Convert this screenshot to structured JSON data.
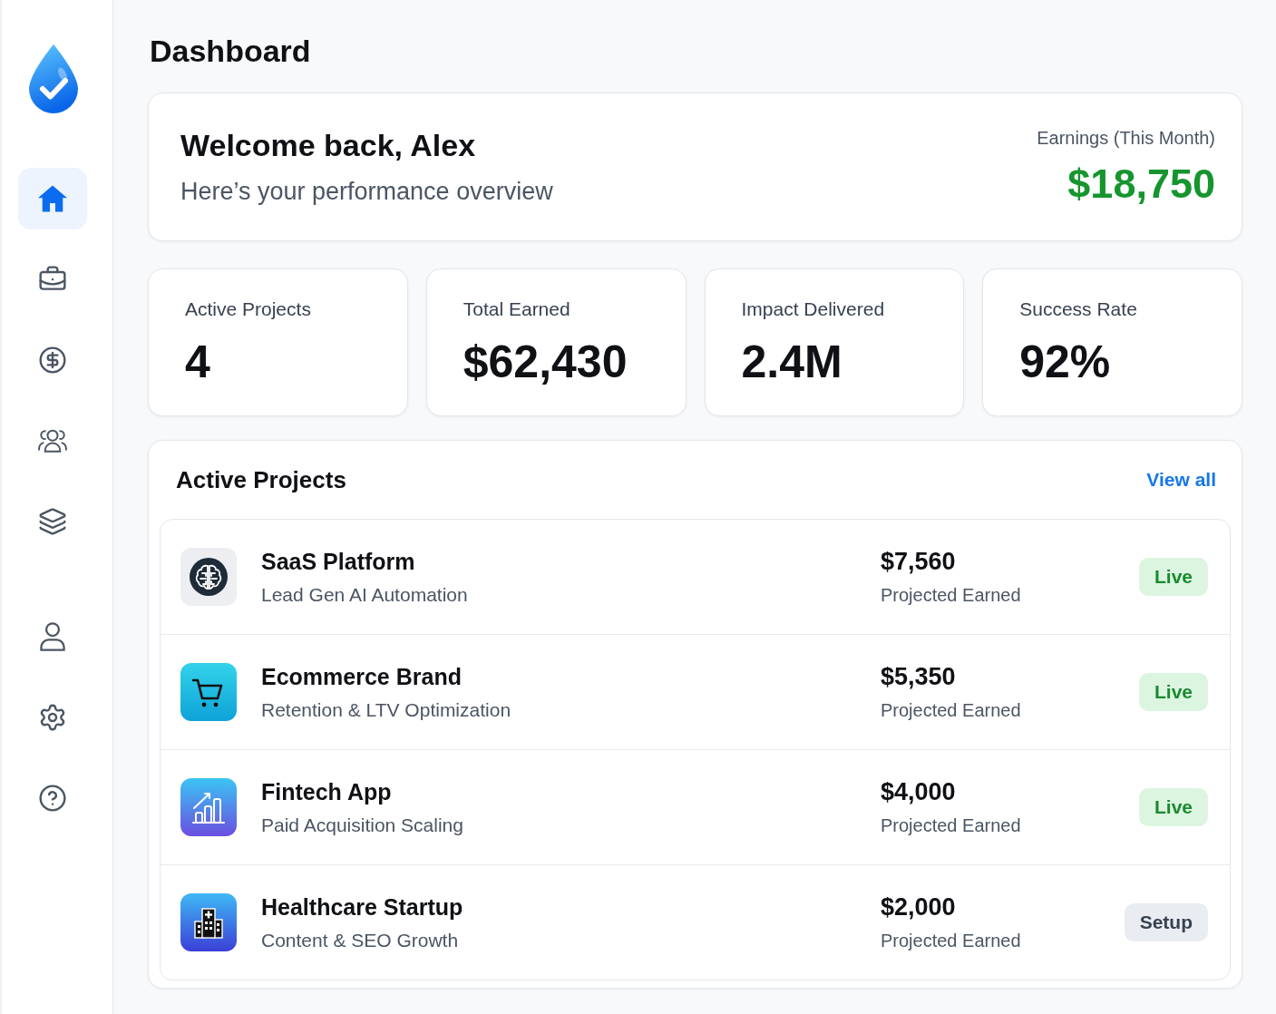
{
  "sidebar": {
    "items": [
      {
        "kind": "home",
        "selected": true
      },
      {
        "kind": "briefcase",
        "selected": false
      },
      {
        "kind": "dollar",
        "selected": false
      },
      {
        "kind": "people",
        "selected": false
      },
      {
        "kind": "layers",
        "selected": false
      }
    ],
    "lower_items": [
      {
        "kind": "user",
        "selected": false
      },
      {
        "kind": "gear",
        "selected": false
      },
      {
        "kind": "help",
        "selected": false
      }
    ]
  },
  "page_title": "Dashboard",
  "welcome": {
    "title": "Welcome back, Alex",
    "subtitle": "Here’s your performance overview",
    "earnings_label": "Earnings (This Month)",
    "earnings_value": "$18,750"
  },
  "stats": [
    {
      "label": "Active Projects",
      "value": "4"
    },
    {
      "label": "Total Earned",
      "value": "$62,430"
    },
    {
      "label": "Impact Delivered",
      "value": "2.4M"
    },
    {
      "label": "Success Rate",
      "value": "92%"
    }
  ],
  "projects": {
    "title": "Active Projects",
    "view_all": "View all",
    "rows": [
      {
        "kind": "brain",
        "name": "SaaS Platform",
        "description": "Lead Gen AI Automation",
        "amount": "$7,560",
        "amount_label": "Projected Earned",
        "status": {
          "kind": "live",
          "label": "Live"
        }
      },
      {
        "kind": "cart",
        "name": "Ecommerce Brand",
        "description": "Retention & LTV Optimization",
        "amount": "$5,350",
        "amount_label": "Projected Earned",
        "status": {
          "kind": "live",
          "label": "Live"
        }
      },
      {
        "kind": "chart",
        "name": "Fintech App",
        "description": "Paid Acquisition Scaling",
        "amount": "$4,000",
        "amount_label": "Projected Earned",
        "status": {
          "kind": "live",
          "label": "Live"
        }
      },
      {
        "kind": "hospital",
        "name": "Healthcare Startup",
        "description": "Content & SEO Growth",
        "amount": "$2,000",
        "amount_label": "Projected Earned",
        "status": {
          "kind": "setup",
          "label": "Setup"
        }
      }
    ]
  }
}
